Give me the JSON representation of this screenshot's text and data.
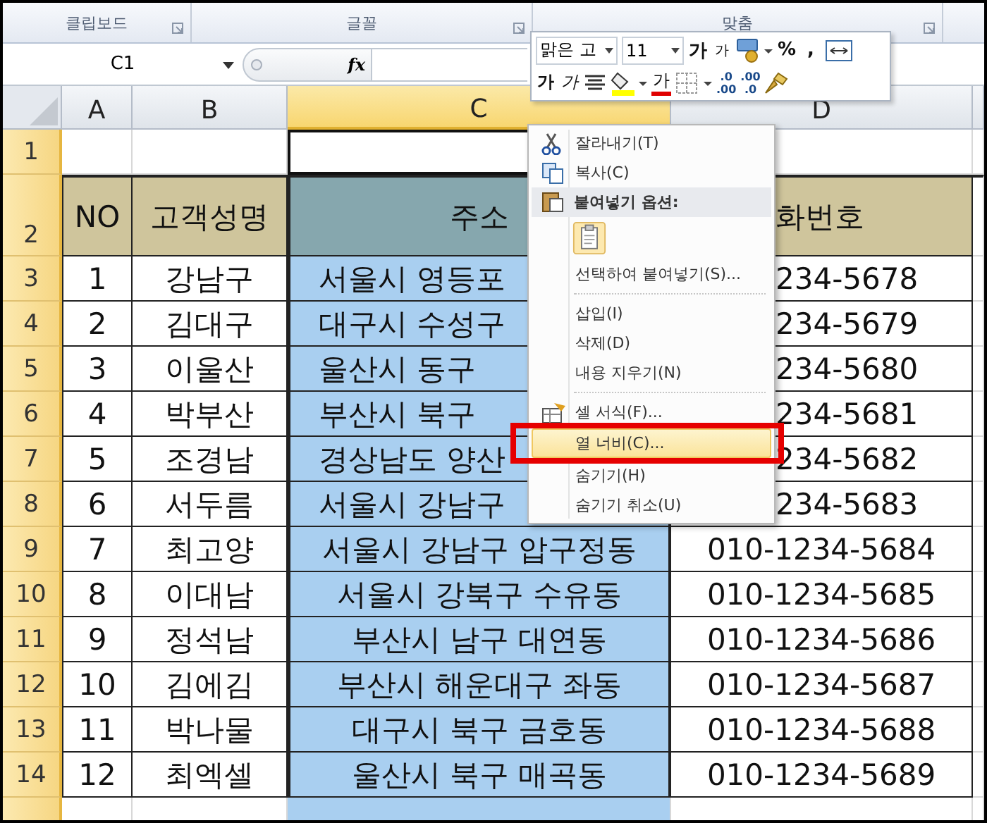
{
  "ribbon_groups": [
    {
      "label": "클립보드"
    },
    {
      "label": "글꼴"
    },
    {
      "label": "맞춤"
    }
  ],
  "formula_bar": {
    "name_box": "C1",
    "fx": "fx"
  },
  "columns": [
    {
      "label": "A",
      "selected": false
    },
    {
      "label": "B",
      "selected": false
    },
    {
      "label": "C",
      "selected": true
    },
    {
      "label": "D",
      "selected": false
    }
  ],
  "rows": [
    {
      "number": "1",
      "kind": "blank"
    },
    {
      "number": "2",
      "kind": "header",
      "a": "NO",
      "b": "고객성명",
      "c": "주소",
      "d": "화번호"
    },
    {
      "number": "3",
      "kind": "data",
      "a": "1",
      "b": "강남구",
      "c": "서울시 영등포",
      "d": "234-5678"
    },
    {
      "number": "4",
      "kind": "data",
      "a": "2",
      "b": "김대구",
      "c": "대구시 수성구",
      "d": "234-5679"
    },
    {
      "number": "5",
      "kind": "data",
      "a": "3",
      "b": "이울산",
      "c": "울산시 동구",
      "d": "234-5680"
    },
    {
      "number": "6",
      "kind": "data",
      "a": "4",
      "b": "박부산",
      "c": "부산시 북구",
      "d": "234-5681"
    },
    {
      "number": "7",
      "kind": "data",
      "a": "5",
      "b": "조경남",
      "c": "경상남도 양산",
      "d": "234-5682"
    },
    {
      "number": "8",
      "kind": "data",
      "a": "6",
      "b": "서두름",
      "c": "서울시 강남구",
      "d": "234-5683"
    },
    {
      "number": "9",
      "kind": "data",
      "a": "7",
      "b": "최고양",
      "c": "서울시 강남구 압구정동",
      "d": "010-1234-5684"
    },
    {
      "number": "10",
      "kind": "data",
      "a": "8",
      "b": "이대남",
      "c": "서울시 강북구 수유동",
      "d": "010-1234-5685"
    },
    {
      "number": "11",
      "kind": "data",
      "a": "9",
      "b": "정석남",
      "c": "부산시 남구 대연동",
      "d": "010-1234-5686"
    },
    {
      "number": "12",
      "kind": "data",
      "a": "10",
      "b": "김에김",
      "c": "부산시 해운대구 좌동",
      "d": "010-1234-5687"
    },
    {
      "number": "13",
      "kind": "data",
      "a": "11",
      "b": "박나물",
      "c": "대구시 북구 금호동",
      "d": "010-1234-5688"
    },
    {
      "number": "14",
      "kind": "data",
      "a": "12",
      "b": "최엑셀",
      "c": "울산시 북구 매곡동",
      "d": "010-1234-5689"
    },
    {
      "kind": "blank"
    }
  ],
  "mini_toolbar": {
    "font_row": [
      {
        "kind": "dropdown",
        "value": "맑은 고"
      },
      {
        "kind": "dropdown",
        "value": "11"
      },
      {
        "kind": "grow",
        "text": "가"
      },
      {
        "kind": "shrink",
        "text": "가"
      },
      {
        "kind": "currency"
      },
      {
        "kind": "text",
        "text": "%"
      },
      {
        "kind": "text",
        "text": ","
      },
      {
        "kind": "merge"
      }
    ],
    "format_row": [
      {
        "kind": "bold",
        "text": "가"
      },
      {
        "kind": "italic",
        "text": "가"
      },
      {
        "kind": "align"
      },
      {
        "kind": "fill"
      },
      {
        "kind": "fontcolor",
        "text": "가"
      },
      {
        "kind": "borders"
      },
      {
        "kind": "decimal",
        "top": ".0",
        "bottom": ".00"
      },
      {
        "kind": "decimal",
        "top": ".00",
        "bottom": ".0"
      },
      {
        "kind": "painter"
      }
    ]
  },
  "context_menu": [
    {
      "kind": "cut",
      "label": "잘라내기(T)",
      "selected": false,
      "annotated": false
    },
    {
      "kind": "copy",
      "label": "복사(C)",
      "selected": false,
      "annotated": false
    },
    {
      "kind": "header",
      "label": "붙여넣기 옵션:"
    },
    {
      "kind": "paste"
    },
    {
      "kind": "item",
      "label": "선택하여 붙여넣기(S)...",
      "selected": false,
      "annotated": false
    },
    {
      "kind": "separator"
    },
    {
      "kind": "item",
      "label": "삽입(I)",
      "selected": false,
      "annotated": false
    },
    {
      "kind": "item",
      "label": "삭제(D)",
      "selected": false,
      "annotated": false
    },
    {
      "kind": "item",
      "label": "내용 지우기(N)",
      "selected": false,
      "annotated": false
    },
    {
      "kind": "separator"
    },
    {
      "kind": "format",
      "label": "셀 서식(F)...",
      "selected": false,
      "annotated": false
    },
    {
      "kind": "item",
      "label": "열 너비(C)...",
      "selected": true,
      "annotated": true
    },
    {
      "kind": "item",
      "label": "숨기기(H)",
      "selected": false,
      "annotated": false
    },
    {
      "kind": "item",
      "label": "숨기기 취소(U)",
      "selected": false,
      "annotated": false
    }
  ]
}
